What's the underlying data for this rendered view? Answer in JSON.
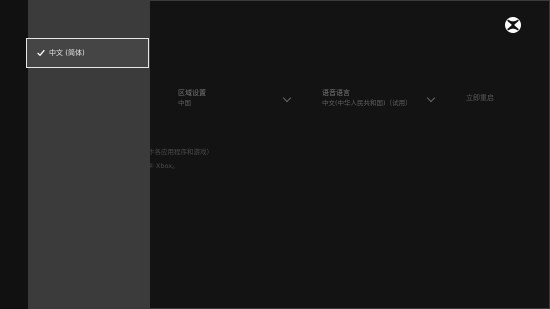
{
  "settings": {
    "region": {
      "label": "区域设置",
      "value": "中国"
    },
    "language": {
      "label": "语音语言",
      "value": "中文(中华人民共和国)（试用）"
    },
    "restart_label": "立即重启"
  },
  "info": {
    "line1": "卞各应用程序和游戏）",
    "line2": "② Xbox。"
  },
  "dropdown": {
    "options": [
      {
        "label": "中文 (简体)",
        "selected": true,
        "icon": "check-icon"
      }
    ]
  },
  "icons": {
    "logo": "xbox-logo-icon"
  },
  "colors": {
    "background": "#111111",
    "panel": "#3b3b3b",
    "focus_border": "#e6e6e6",
    "logo": "#ffffff"
  }
}
